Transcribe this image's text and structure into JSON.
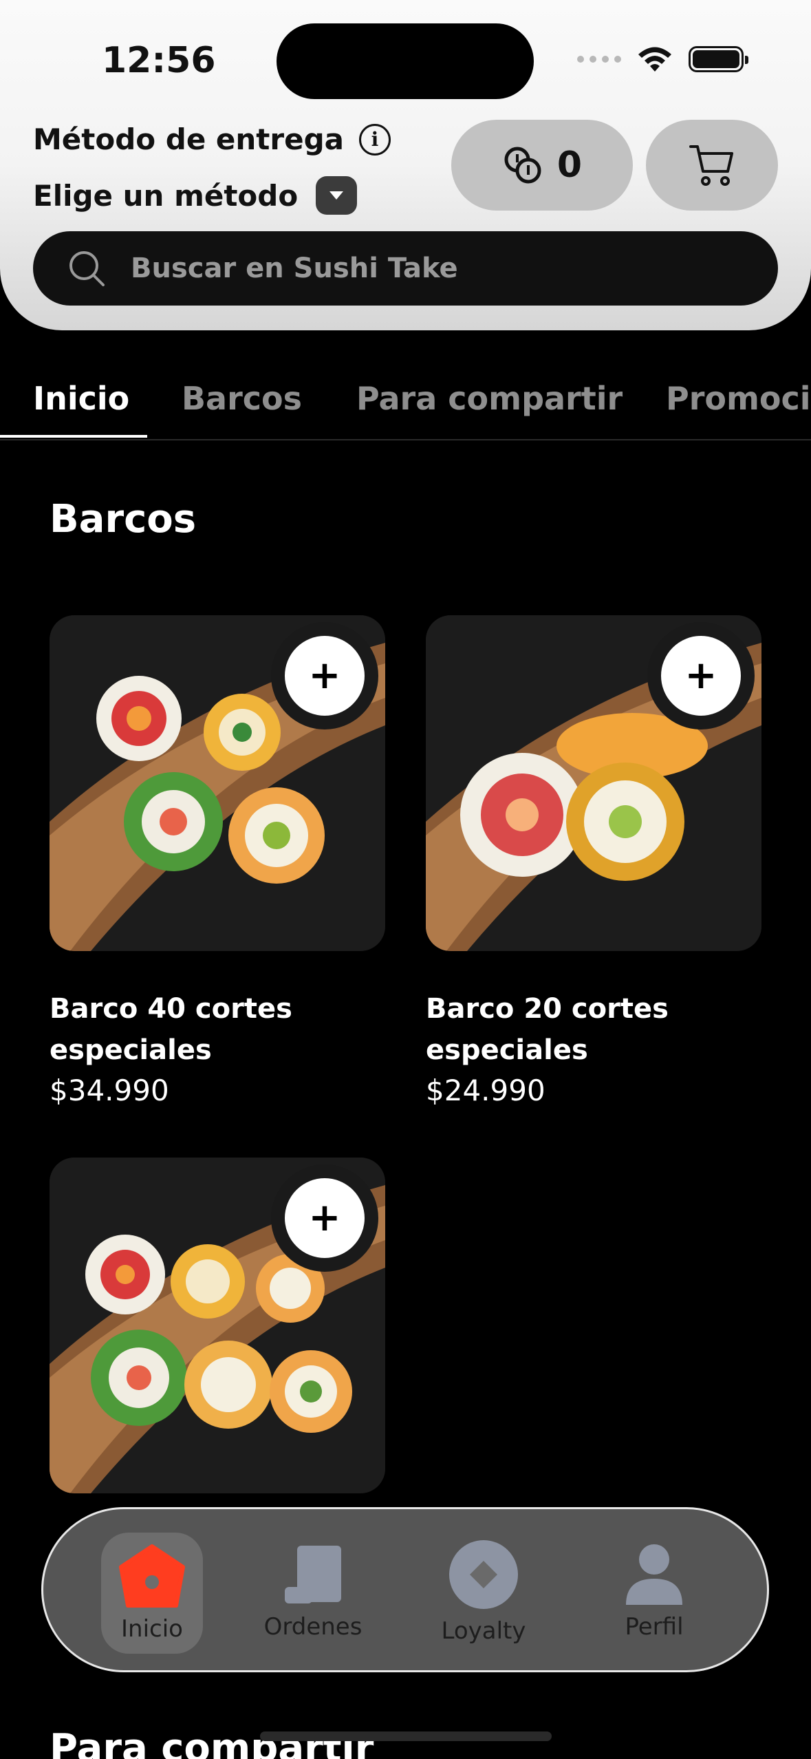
{
  "status_bar": {
    "time": "12:56"
  },
  "header": {
    "delivery_label": "Método de entrega",
    "delivery_value": "Elige un método",
    "points_count": "0"
  },
  "search": {
    "placeholder": "Buscar en Sushi Take"
  },
  "tabs": [
    {
      "label": "Inicio",
      "active": true
    },
    {
      "label": "Barcos",
      "active": false
    },
    {
      "label": "Para compartir",
      "active": false
    },
    {
      "label": "Promocio",
      "active": false
    }
  ],
  "section": {
    "title": "Barcos"
  },
  "products": [
    {
      "name": "Barco 40 cortes especiales",
      "price": "$34.990",
      "image": "sushi-boat-photo"
    },
    {
      "name": "Barco 20 cortes especiales",
      "price": "$24.990",
      "image": "sushi-boat-photo"
    },
    {
      "name": "",
      "price": "",
      "image": "sushi-boat-photo"
    }
  ],
  "next_section": {
    "title": "Para compartir"
  },
  "bottom_nav": [
    {
      "label": "Inicio",
      "icon": "home-icon",
      "active": true
    },
    {
      "label": "Ordenes",
      "icon": "receipt-icon",
      "active": false
    },
    {
      "label": "Loyalty",
      "icon": "loyalty-icon",
      "active": false
    },
    {
      "label": "Perfil",
      "icon": "user-icon",
      "active": false
    }
  ],
  "colors": {
    "accent": "#ff3d1f",
    "nav_icon": "#8d94a3"
  }
}
